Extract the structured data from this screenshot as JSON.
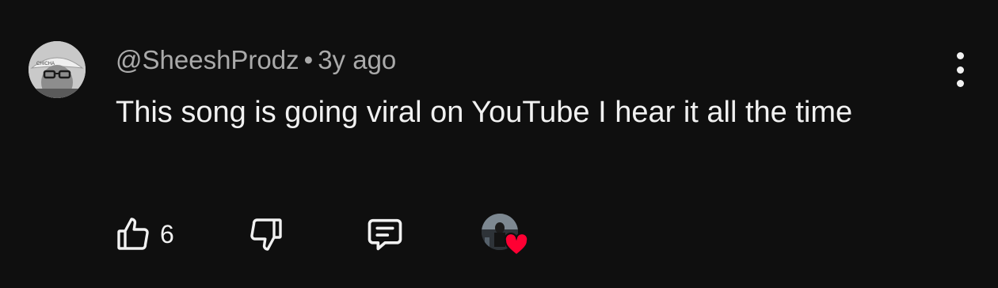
{
  "comment": {
    "author": "@SheeshProdz",
    "separator": "•",
    "time": "3y ago",
    "text": "This song is going viral on YouTube I hear it all the time",
    "like_count": "6",
    "avatar_hat_text": "CHICHA"
  },
  "icons": {
    "like": "thumbs-up-icon",
    "dislike": "thumbs-down-icon",
    "reply": "reply-comment-icon",
    "menu": "more-vertical-icon",
    "heart": "heart-icon"
  },
  "colors": {
    "background": "#0f0f0f",
    "primary_text": "#f1f1f1",
    "secondary_text": "#aaaaaa",
    "heart": "#ff0033"
  }
}
